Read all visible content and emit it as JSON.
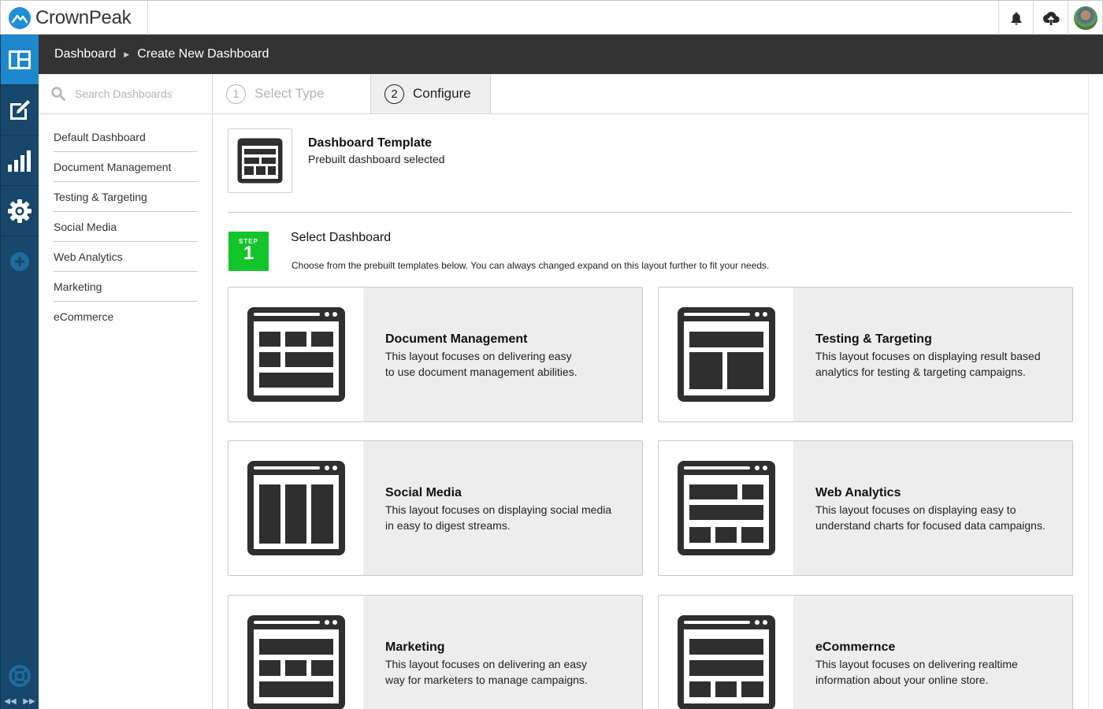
{
  "app": {
    "name": "CrownPeak"
  },
  "header": {
    "icons": [
      "bell-icon",
      "cloud-upload-icon",
      "user-avatar"
    ]
  },
  "rail": {
    "items": [
      "dashboard-icon",
      "edit-icon",
      "analytics-icon",
      "settings-icon",
      "add-icon"
    ],
    "active": "dashboard-icon",
    "bottom": [
      "help-icon",
      "collapse-icon",
      "expand-icon"
    ]
  },
  "breadcrumb": {
    "items": [
      "Dashboard",
      "Create New Dashboard"
    ]
  },
  "sidebar": {
    "search_placeholder": "Search Dashboards",
    "items": [
      "Default Dashboard",
      "Document Management",
      "Testing & Targeting",
      "Social Media",
      "Web Analytics",
      "Marketing",
      "eCommerce"
    ]
  },
  "wizard": {
    "tabs": [
      {
        "num": "1",
        "label": "Select Type",
        "active": false
      },
      {
        "num": "2",
        "label": "Configure",
        "active": true
      }
    ]
  },
  "template": {
    "title": "Dashboard Template",
    "subtitle": "Prebuilt dashboard selected"
  },
  "step": {
    "word": "STEP",
    "number": "1",
    "title": "Select Dashboard",
    "description": "Choose from the prebuilt templates below. You can always changed expand on this layout further to fit your needs."
  },
  "cards": [
    {
      "title": "Document Management",
      "desc1": "This layout focuses on delivering easy",
      "desc2": "to use document management abilities."
    },
    {
      "title": "Testing & Targeting",
      "desc1": "This layout focuses on displaying result based",
      "desc2": "analytics for testing & targeting campaigns."
    },
    {
      "title": "Social Media",
      "desc1": "This layout focuses on displaying social media",
      "desc2": "in easy to digest streams."
    },
    {
      "title": "Web Analytics",
      "desc1": "This layout focuses on displaying easy to",
      "desc2": "understand charts for focused data campaigns."
    },
    {
      "title": "Marketing",
      "desc1": "This layout focuses on delivering an easy",
      "desc2": "way for marketers to manage campaigns."
    },
    {
      "title": "eCommernce",
      "desc1": "This layout focuses on delivering realtime",
      "desc2": "information about your online store."
    }
  ],
  "colors": {
    "rail_bg": "#17476a",
    "rail_active": "#1e88cc",
    "breadcrumb_bg": "#333333",
    "step_badge": "#13c52b",
    "card_bg": "#ededed",
    "icon_fill": "#2f2f2f"
  }
}
